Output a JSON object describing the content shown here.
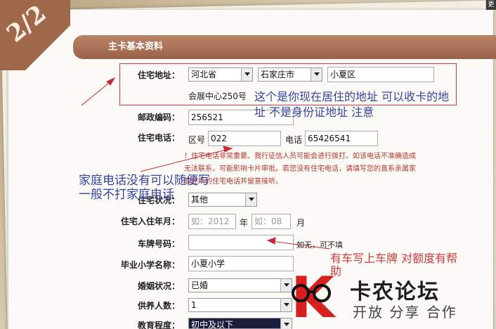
{
  "page_indicator": "2/2",
  "top_right_button": "更",
  "section_title": "主卡基本资料",
  "address": {
    "label": "住宅地址：",
    "province": "河北省",
    "city": "石家庄市",
    "district": "小夏区",
    "detail": "会展中心250号"
  },
  "postal": {
    "label": "邮政编码：",
    "value": "256521"
  },
  "phone": {
    "label": "住宅电话：",
    "area_label": "区号",
    "area_code": "022",
    "number_label": "电话",
    "number": "65426541",
    "warning_line1": "！住宅电话非常重要。我行征信人员可能会进行拨打。如该电话不准确造成",
    "warning_line2": "无法联系，可能影响卡片审批。若您没有住宅电话，请填写您的直系亲属家",
    "warning_line3": "庭住所的住宅电话并留意接听。"
  },
  "residence_status": {
    "label": "住宅状况：",
    "value": "其他"
  },
  "move_in": {
    "label": "住宅入住年月：",
    "year_placeholder": "如：2012",
    "year_unit": "年",
    "month_placeholder": "如：08",
    "month_unit": "月"
  },
  "plate": {
    "label": "车牌号码：",
    "value": "",
    "note": "如无，可不填"
  },
  "primary_school": {
    "label": "毕业小学名称：",
    "value": "小夏小学"
  },
  "marital": {
    "label": "婚姻状况：",
    "value": "已婚"
  },
  "dependents": {
    "label": "供养人数：",
    "value": "1"
  },
  "education": {
    "label": "教育程度：",
    "value": "初中及以下"
  },
  "annotations": {
    "address_note_1": "这个是你现在居住的地址 可以收卡的地",
    "address_note_2": "址 不是身份证地址 注意",
    "phone_note_1": "家庭电话没有可以随便写",
    "phone_note_2": "一般不打家庭电话",
    "car_note_1": "有车写上车牌 对额度有帮",
    "car_note_2": "助"
  },
  "watermark": {
    "name": "卡农论坛",
    "slogan": "开放 分享 合作"
  },
  "colors": {
    "header": "#a0684b",
    "annotation_blue": "#3644a0",
    "annotation_red": "#d2393c",
    "warning_red": "#b2372c",
    "logo_red": "#d71f1f"
  }
}
